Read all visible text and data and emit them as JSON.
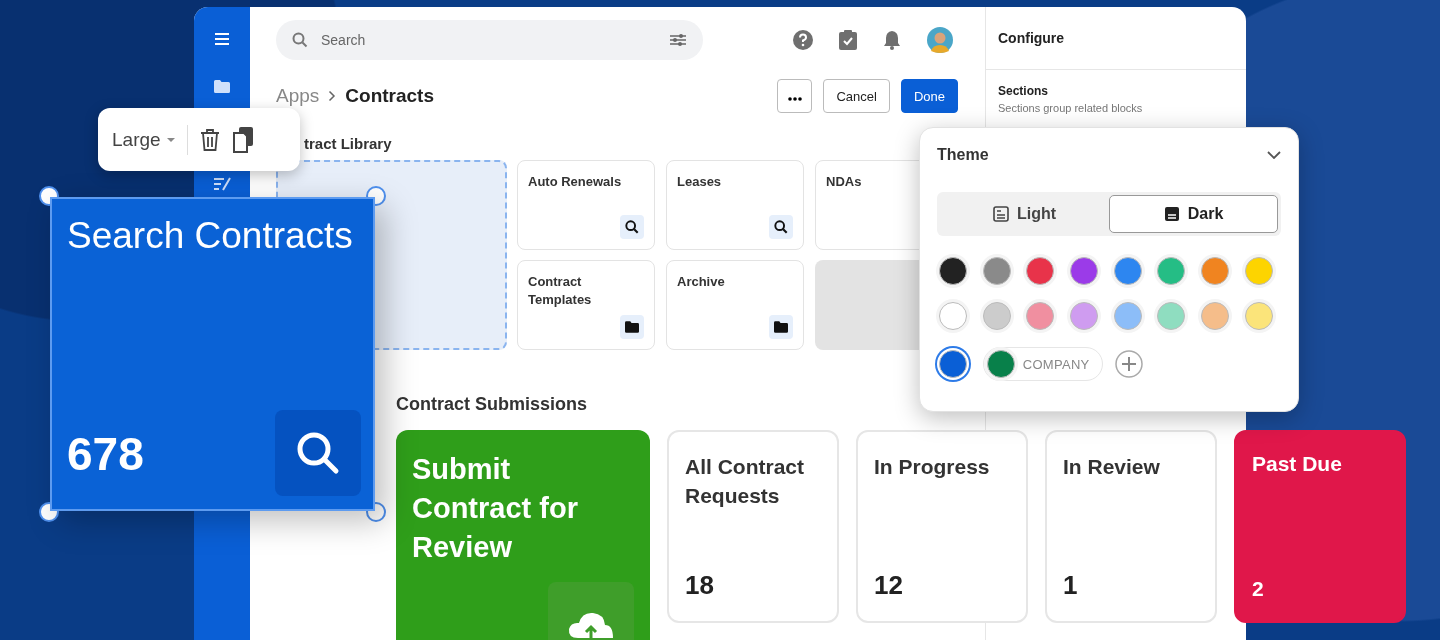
{
  "search": {
    "placeholder": "Search"
  },
  "breadcrumb": [
    "Apps",
    "Contracts"
  ],
  "actions": [
    {
      "kind": "more"
    },
    {
      "kind": "secondary",
      "label": "Cancel"
    },
    {
      "kind": "primary",
      "label": "Done"
    }
  ],
  "library": {
    "title": "tract Library",
    "tiles": [
      {
        "kind": "placeholder"
      },
      {
        "kind": "search",
        "title": "Auto Renewals"
      },
      {
        "kind": "search",
        "title": "Leases"
      },
      {
        "kind": "plain",
        "title": "NDAs"
      },
      {
        "kind": "folder",
        "title": "Contract Templates"
      },
      {
        "kind": "folder",
        "title": "Archive"
      },
      {
        "kind": "empty"
      }
    ]
  },
  "configure": {
    "title": "Configure",
    "section": {
      "title": "Sections",
      "subtitle": "Sections group related blocks"
    }
  },
  "theme": {
    "title": "Theme",
    "modes": [
      {
        "label": "Light",
        "selected": false
      },
      {
        "label": "Dark",
        "selected": true
      }
    ],
    "swatches": [
      {
        "color": "#222222",
        "selected": false
      },
      {
        "color": "#8a8a8a",
        "selected": false
      },
      {
        "color": "#e8334a",
        "selected": false
      },
      {
        "color": "#9b3be8",
        "selected": false
      },
      {
        "color": "#2d86f0",
        "selected": false
      },
      {
        "color": "#25bd85",
        "selected": false
      },
      {
        "color": "#f08420",
        "selected": false
      },
      {
        "color": "#fdd400",
        "selected": false
      },
      {
        "color": "#ffffff",
        "selected": false
      },
      {
        "color": "#cccccc",
        "selected": false
      },
      {
        "color": "#f08fa0",
        "selected": false
      },
      {
        "color": "#cf9cf0",
        "selected": false
      },
      {
        "color": "#8cbdf8",
        "selected": false
      },
      {
        "color": "#8fddc0",
        "selected": false
      },
      {
        "color": "#f5bd8a",
        "selected": false
      },
      {
        "color": "#fbe47a",
        "selected": false
      },
      {
        "color": "#0a5fd6",
        "selected": true
      },
      {
        "color": "#08804a",
        "selected": false,
        "label": "COMPANY"
      }
    ]
  },
  "toolbar": {
    "size": "Large"
  },
  "featured": {
    "title": "Search Contracts",
    "count": "678",
    "selected": true
  },
  "submissions": {
    "title": "Contract Submissions",
    "cards": [
      {
        "kind": "action",
        "title": "Submit Contract for Review"
      },
      {
        "kind": "stat",
        "title": "All Contract Requests",
        "count": "18"
      },
      {
        "kind": "stat",
        "title": "In Progress",
        "count": "12"
      },
      {
        "kind": "stat",
        "title": "In Review",
        "count": "1"
      },
      {
        "kind": "alert",
        "title": "Past Due",
        "count": "2"
      }
    ]
  }
}
